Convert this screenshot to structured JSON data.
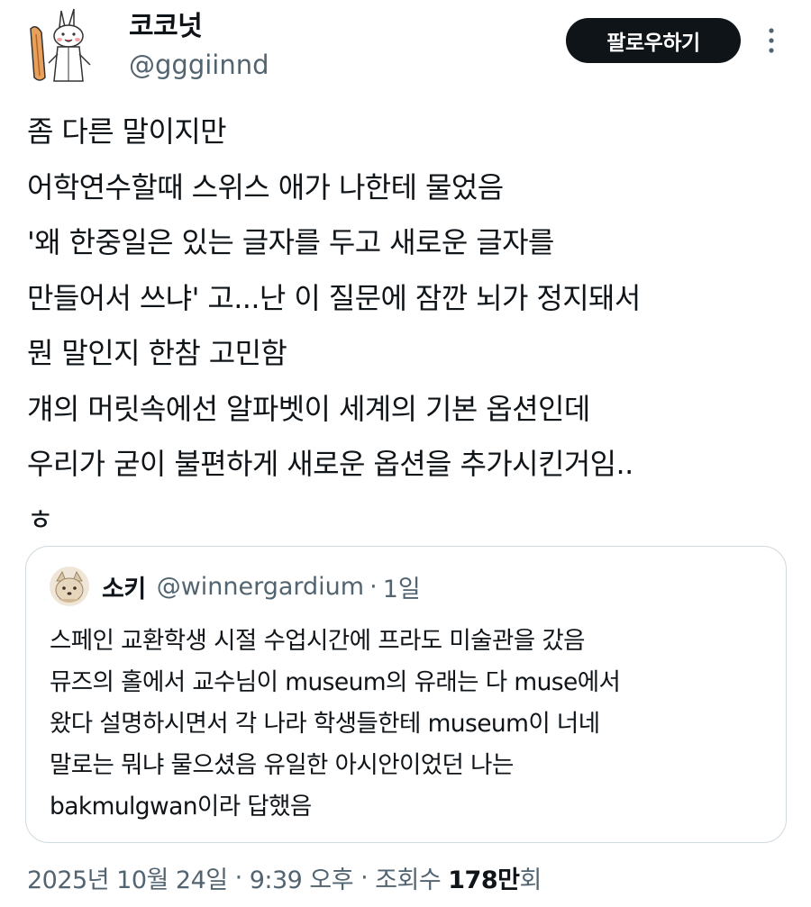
{
  "author": {
    "display_name": "코코넛",
    "handle": "@gggiinnd",
    "avatar_icon": "rabbit-doodle-avatar-icon"
  },
  "follow_button_label": "팔로우하기",
  "more_icon": "more-vertical-icon",
  "tweet": {
    "lines": [
      "좀 다른 말이지만",
      "어학연수할때 스위스 애가 나한테 물었음",
      "'왜 한중일은 있는 글자를 두고 새로운 글자를",
      "만들어서 쓰냐' 고...난 이 질문에 잠깐 뇌가 정지돼서",
      "뭔 말인지 한참 고민함",
      "걔의 머릿속에선 알파벳이 세계의 기본 옵션인데",
      "우리가 굳이 불편하게 새로운 옵션을 추가시킨거임..",
      "ㅎ"
    ]
  },
  "quote": {
    "display_name": "소키",
    "handle": "@winnergardium",
    "separator": "·",
    "time": "1일",
    "avatar_icon": "fox-avatar-icon",
    "lines": [
      "스페인 교환학생 시절 수업시간에 프라도 미술관을 갔음",
      "뮤즈의 홀에서 교수님이 museum의 유래는 다 muse에서",
      "왔다 설명하시면서 각 나라 학생들한테 museum이 너네",
      "말로는 뭐냐 물으셨음 유일한 아시안이었던 나는",
      "bakmulgwan이라 답했음"
    ]
  },
  "meta": {
    "date": "2025년 10월 24일",
    "separator": "·",
    "time": "9:39 오후",
    "views_label": "조회수",
    "views_count": "178만",
    "views_suffix": "회"
  }
}
